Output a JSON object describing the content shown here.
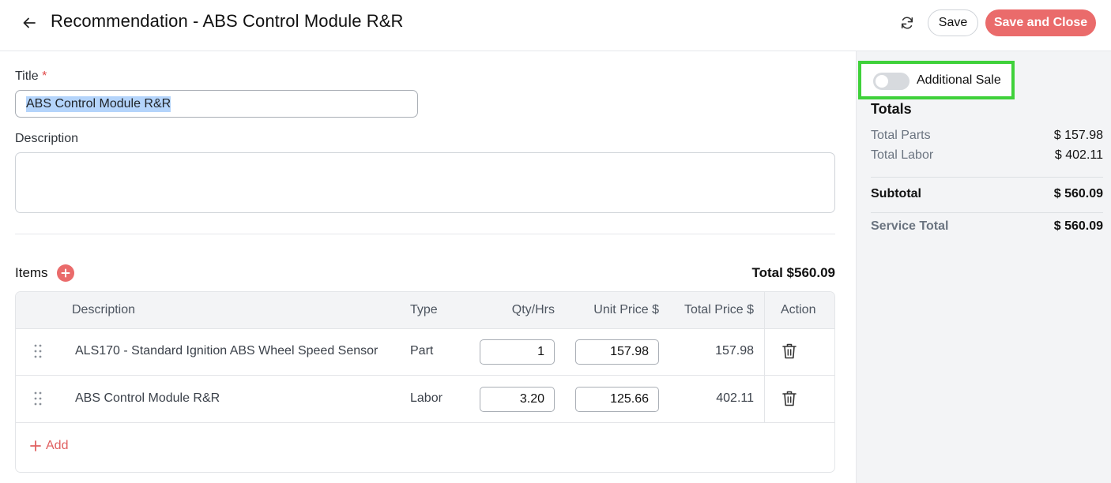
{
  "header": {
    "title": "Recommendation - ABS Control Module R&R",
    "save_label": "Save",
    "save_close_label": "Save and Close",
    "accent_color": "#ea6b6b"
  },
  "form": {
    "title_label": "Title",
    "required_mark": "*",
    "title_value": "ABS Control Module R&R",
    "description_label": "Description",
    "description_value": ""
  },
  "items": {
    "label": "Items",
    "total_text": "Total $560.09",
    "add_label": "Add",
    "columns": [
      "Description",
      "Type",
      "Qty/Hrs",
      "Unit Price $",
      "Total Price $",
      "Action"
    ],
    "rows": [
      {
        "description": "ALS170 - Standard Ignition ABS Wheel Speed Sensor",
        "type": "Part",
        "qty": "1",
        "unit_price": "157.98",
        "total_price": "157.98"
      },
      {
        "description": "ABS Control Module R&R",
        "type": "Labor",
        "qty": "3.20",
        "unit_price": "125.66",
        "total_price": "402.11"
      }
    ]
  },
  "sidebar": {
    "additional_sale_label": "Additional Sale",
    "additional_sale_on": false,
    "highlight_color": "#3fd13a",
    "totals_title": "Totals",
    "total_parts_label": "Total Parts",
    "total_parts_value": "$ 157.98",
    "total_labor_label": "Total Labor",
    "total_labor_value": "$ 402.11",
    "subtotal_label": "Subtotal",
    "subtotal_value": "$ 560.09",
    "service_total_label": "Service Total",
    "service_total_value": "$ 560.09"
  },
  "icons": {
    "back": "arrow-left-icon",
    "refresh": "refresh-icon",
    "add": "plus-circle-icon",
    "drag": "drag-handle-icon",
    "delete": "trash-icon"
  }
}
